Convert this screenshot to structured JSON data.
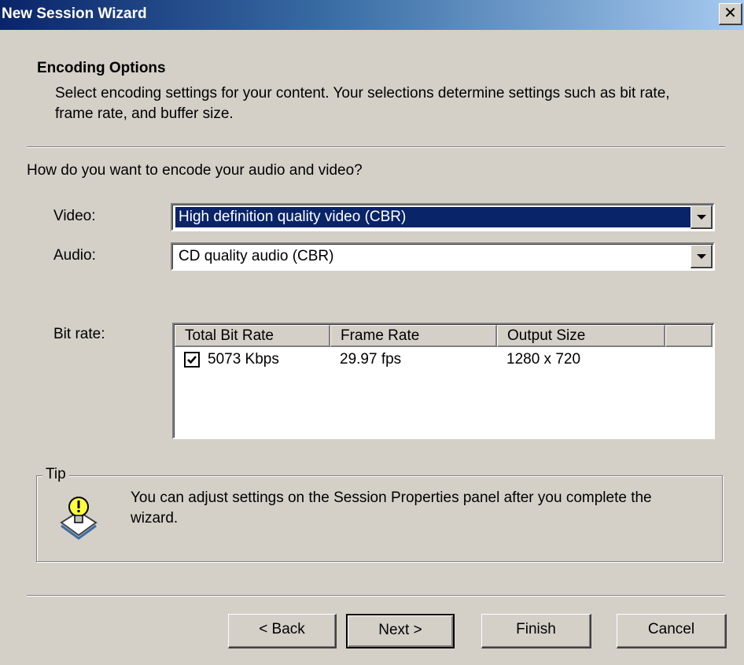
{
  "window": {
    "title": "New Session Wizard",
    "close_glyph": "✕"
  },
  "header": {
    "title": "Encoding Options",
    "description": "Select encoding settings for your content. Your selections determine settings such as bit rate, frame rate, and buffer size."
  },
  "form": {
    "question": "How do you want to encode your audio and video?",
    "video": {
      "label": "Video:",
      "value": "High definition quality video (CBR)"
    },
    "audio": {
      "label": "Audio:",
      "value": "CD quality audio (CBR)"
    },
    "bitrate": {
      "label": "Bit rate:",
      "columns": [
        "Total Bit Rate",
        "Frame Rate",
        "Output Size"
      ],
      "rows": [
        {
          "checked": true,
          "total_bit_rate": "5073 Kbps",
          "frame_rate": "29.97 fps",
          "output_size": "1280 x 720"
        }
      ]
    }
  },
  "tip": {
    "title": "Tip",
    "icon": "lightbulb-icon",
    "text": "You can adjust settings on the Session Properties panel after you complete the wizard."
  },
  "buttons": {
    "back": "< Back",
    "next": "Next >",
    "finish": "Finish",
    "cancel": "Cancel"
  },
  "colors": {
    "face": "#d4d0c8",
    "title_start": "#0a246a",
    "title_end": "#a6caf0",
    "selection": "#0a246a"
  }
}
